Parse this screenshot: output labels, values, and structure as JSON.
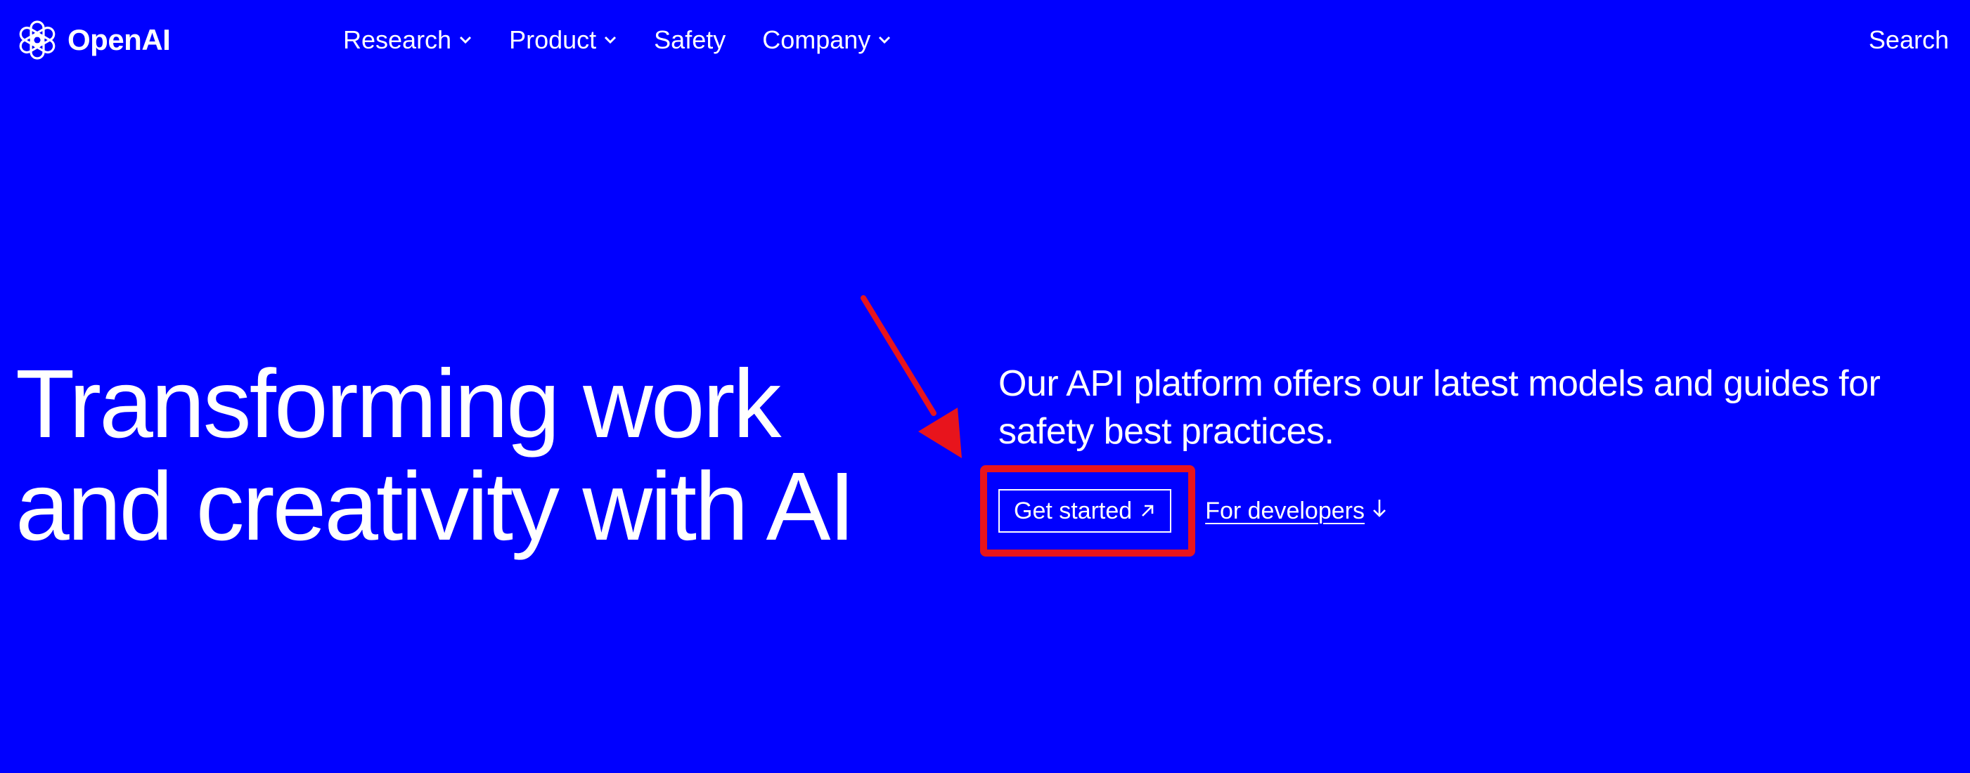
{
  "header": {
    "brand": "OpenAI",
    "nav": [
      {
        "label": "Research",
        "has_dropdown": true
      },
      {
        "label": "Product",
        "has_dropdown": true
      },
      {
        "label": "Safety",
        "has_dropdown": false
      },
      {
        "label": "Company",
        "has_dropdown": true
      }
    ],
    "search_label": "Search"
  },
  "hero": {
    "headline": "Transforming work and creativity with AI",
    "description": "Our API platform offers our latest models and guides for safety best practices.",
    "primary_cta": "Get started",
    "secondary_cta": "For developers"
  },
  "icons": {
    "logo": "openai-logo-icon",
    "dropdown": "chevron-down-icon",
    "external": "arrow-up-right-icon",
    "down": "arrow-down-icon"
  },
  "colors": {
    "background": "#0000ff",
    "text": "#ffffff",
    "annotation": "#e8141c"
  }
}
